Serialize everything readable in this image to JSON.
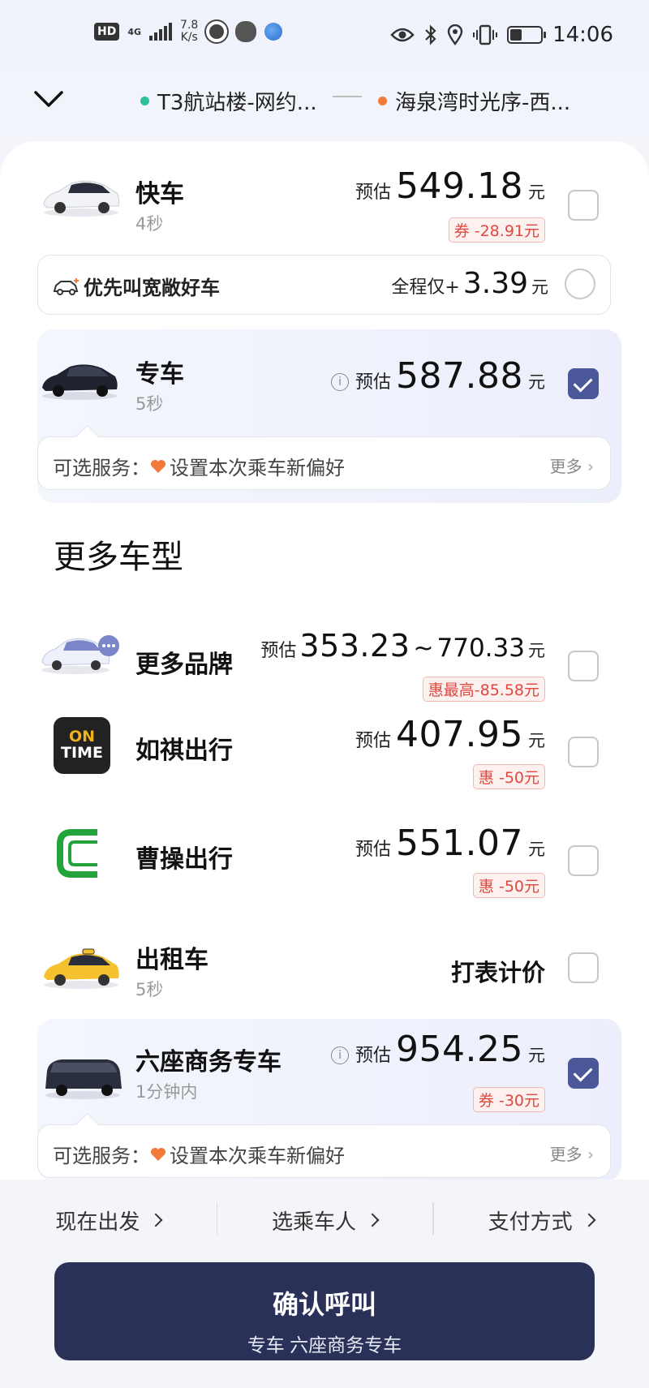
{
  "status_bar": {
    "hd": "HD",
    "net_type": "4G",
    "speed_value": "7.8",
    "speed_unit": "K/s",
    "time": "14:06"
  },
  "route": {
    "from": "T3航站楼-网约...",
    "to": "海泉湾时光序-西...",
    "from_color": "#2bbf9a",
    "to_color": "#f07a3a"
  },
  "services": {
    "kuaiche": {
      "name": "快车",
      "eta": "4秒",
      "est_label": "预估",
      "price": "549.18",
      "unit": "元",
      "coupon": "券 -28.91元",
      "checked": false
    },
    "upgrade": {
      "label": "优先叫宽敞好车",
      "price_label": "全程仅+",
      "price": "3.39",
      "unit": "元"
    },
    "zhuanche": {
      "name": "专车",
      "eta": "5秒",
      "est_label": "预估",
      "price": "587.88",
      "unit": "元",
      "checked": true,
      "optional_label": "可选服务：",
      "optional_text": "设置本次乘车新偏好",
      "more": "更多"
    }
  },
  "more_section": {
    "title": "更多车型",
    "brands": {
      "name": "更多品牌",
      "est_label": "预估",
      "price_low": "353.23",
      "tilde": "~",
      "price_high": "770.33",
      "unit": "元",
      "coupon": "惠最高-85.58元"
    },
    "ruqi": {
      "name": "如祺出行",
      "logo_text_1": "ON",
      "logo_text_2": "TIME",
      "est_label": "预估",
      "price": "407.95",
      "unit": "元",
      "coupon": "惠 -50元"
    },
    "caocao": {
      "name": "曹操出行",
      "est_label": "预估",
      "price": "551.07",
      "unit": "元",
      "coupon": "惠 -50元"
    },
    "taxi": {
      "name": "出租车",
      "eta": "5秒",
      "meter": "打表计价"
    },
    "six_seat": {
      "name": "六座商务专车",
      "eta": "1分钟内",
      "est_label": "预估",
      "price": "954.25",
      "unit": "元",
      "coupon": "券 -30元",
      "checked": true,
      "optional_label": "可选服务：",
      "optional_text": "设置本次乘车新偏好",
      "more": "更多"
    }
  },
  "bottom": {
    "depart": "现在出发",
    "passenger": "选乘车人",
    "payment": "支付方式",
    "confirm": "确认呼叫",
    "confirm_sub": "专车 六座商务专车"
  },
  "colors": {
    "accent": "#4a5899",
    "confirm_bg": "#2a3159",
    "coupon_red": "#e0473f"
  }
}
